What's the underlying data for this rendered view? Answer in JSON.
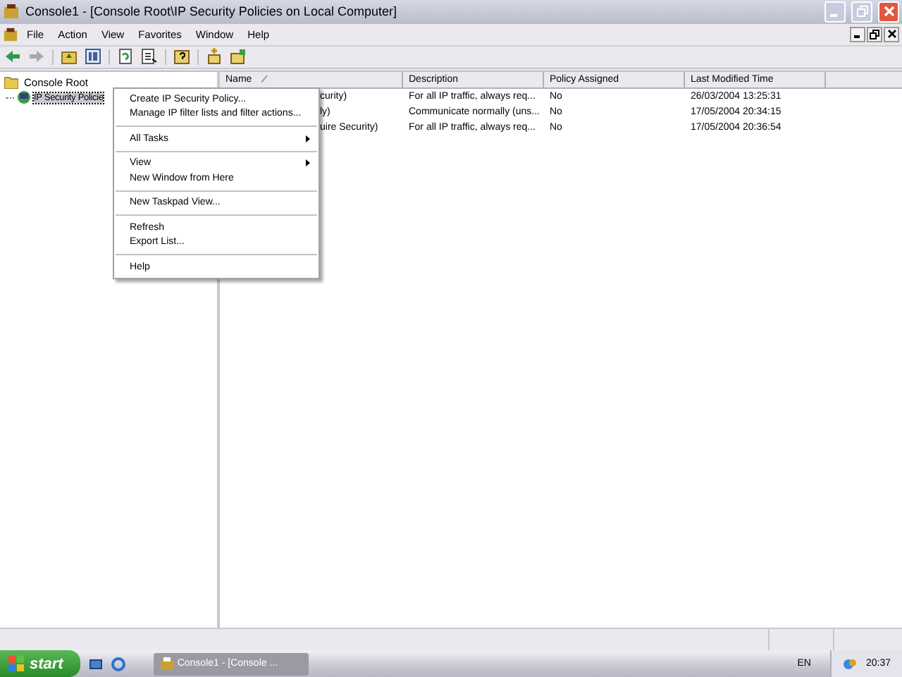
{
  "window": {
    "title": "Console1 - [Console Root\\IP Security Policies on Local Computer]"
  },
  "menu_bar": [
    {
      "label": "File"
    },
    {
      "label": "Action"
    },
    {
      "label": "View"
    },
    {
      "label": "Favorites"
    },
    {
      "label": "Window"
    },
    {
      "label": "Help"
    }
  ],
  "tree": [
    {
      "label": "Console Root",
      "selected": false,
      "children": [
        {
          "label": "IP Security Policie",
          "selected": true
        }
      ]
    }
  ],
  "list": {
    "columns": [
      "Name",
      "Description",
      "Policy Assigned",
      "Last Modified Time"
    ],
    "rows": [
      {
        "name": "curity)",
        "description": "For all IP traffic, always req...",
        "policy_assigned": "No",
        "last_modified": "26/03/2004 13:25:31"
      },
      {
        "name": "ly)",
        "description": "Communicate normally (uns...",
        "policy_assigned": "No",
        "last_modified": "17/05/2004 20:34:15"
      },
      {
        "name": "uire Security)",
        "description": "For all IP traffic, always req...",
        "policy_assigned": "No",
        "last_modified": "17/05/2004 20:36:54"
      }
    ]
  },
  "context_menu": [
    {
      "kind": "item",
      "label": "Create IP Security Policy...",
      "submenu": false
    },
    {
      "kind": "item",
      "label": "Manage IP filter lists and filter actions...",
      "submenu": false
    },
    {
      "kind": "separator"
    },
    {
      "kind": "item",
      "label": "All Tasks",
      "submenu": true
    },
    {
      "kind": "separator"
    },
    {
      "kind": "item",
      "label": "View",
      "submenu": true
    },
    {
      "kind": "item",
      "label": "New Window from Here",
      "submenu": false
    },
    {
      "kind": "separator"
    },
    {
      "kind": "item",
      "label": "New Taskpad View...",
      "submenu": false
    },
    {
      "kind": "separator"
    },
    {
      "kind": "item",
      "label": "Refresh",
      "submenu": false
    },
    {
      "kind": "item",
      "label": "Export List...",
      "submenu": false
    },
    {
      "kind": "separator"
    },
    {
      "kind": "item",
      "label": "Help",
      "submenu": false
    }
  ],
  "taskbar": {
    "start": "start",
    "tasks": [
      {
        "label": "Console1 - [Console ...",
        "selected": false
      }
    ],
    "language": "EN",
    "clock": "20:37"
  }
}
